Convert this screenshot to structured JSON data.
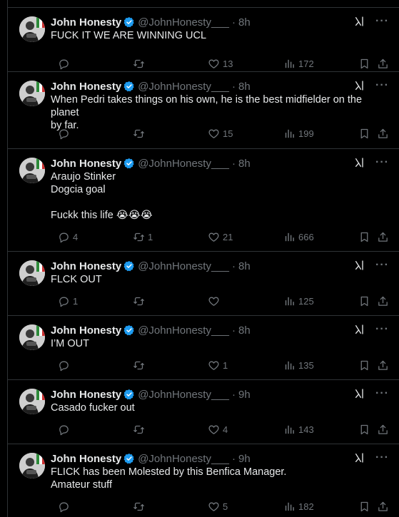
{
  "colors": {
    "background": "#000000",
    "text": "#e7e9ea",
    "muted": "#71767b",
    "verified": "#1d9bf0",
    "divider": "#2f3336"
  },
  "icons": {
    "reply": "speech-bubble-icon",
    "retweet": "retweet-icon",
    "like": "heart-icon",
    "views": "bar-chart-icon",
    "bookmark": "bookmark-icon",
    "share": "share-icon",
    "grok": "grok-icon",
    "more": "more-icon",
    "verified": "verified-badge-icon"
  },
  "tweets": [
    {
      "name": "John Honesty",
      "handle": "@JohnHonesty___",
      "dot": "·",
      "time": "8h",
      "lines": [
        "FUCK IT WE ARE WINNING UCL"
      ],
      "replies": "",
      "retweets": "",
      "likes": "13",
      "views": "172"
    },
    {
      "name": "John Honesty",
      "handle": "@JohnHonesty___",
      "dot": "·",
      "time": "8h",
      "lines": [
        "When Pedri takes things on his own, he is the best midfielder on the planet",
        "by far."
      ],
      "replies": "",
      "retweets": "",
      "likes": "15",
      "views": "199"
    },
    {
      "name": "John Honesty",
      "handle": "@JohnHonesty___",
      "dot": "·",
      "time": "8h",
      "lines": [
        "Araujo Stinker",
        "Dogcia goal",
        "",
        "Fuckk this life 😭😭😭"
      ],
      "replies": "4",
      "retweets": "1",
      "likes": "21",
      "views": "666"
    },
    {
      "name": "John Honesty",
      "handle": "@JohnHonesty___",
      "dot": "·",
      "time": "8h",
      "lines": [
        "FLCK OUT"
      ],
      "replies": "1",
      "retweets": "",
      "likes": "",
      "views": "125"
    },
    {
      "name": "John Honesty",
      "handle": "@JohnHonesty___",
      "dot": "·",
      "time": "8h",
      "lines": [
        "I’M OUT"
      ],
      "replies": "",
      "retweets": "",
      "likes": "1",
      "views": "135"
    },
    {
      "name": "John Honesty",
      "handle": "@JohnHonesty___",
      "dot": "·",
      "time": "9h",
      "lines": [
        "Casado fucker out"
      ],
      "replies": "",
      "retweets": "",
      "likes": "4",
      "views": "143"
    },
    {
      "name": "John Honesty",
      "handle": "@JohnHonesty___",
      "dot": "·",
      "time": "9h",
      "lines": [
        "FLICK has been Molested by this Benfica Manager.",
        "Amateur stuff"
      ],
      "replies": "",
      "retweets": "",
      "likes": "5",
      "views": "182"
    }
  ]
}
